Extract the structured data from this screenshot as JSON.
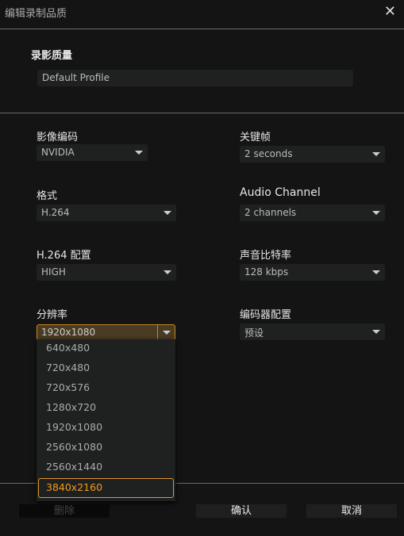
{
  "dialog": {
    "title": "编辑录制品质"
  },
  "quality": {
    "label": "录影质量",
    "profile": "Default Profile"
  },
  "fields": {
    "video_encoder": {
      "label": "影像编码",
      "value": "NVIDIA"
    },
    "keyframe": {
      "label": "关键帧",
      "value": "2 seconds"
    },
    "format": {
      "label": "格式",
      "value": "H.264"
    },
    "audio_channel": {
      "label": "Audio Channel",
      "value": "2 channels"
    },
    "h264_profile": {
      "label": "H.264 配置",
      "value": "HIGH"
    },
    "audio_bitrate": {
      "label": "声音比特率",
      "value": "128 kbps"
    },
    "resolution": {
      "label": "分辨率",
      "value": "1920x1080",
      "options": [
        "640x480",
        "720x480",
        "720x576",
        "1280x720",
        "1920x1080",
        "2560x1080",
        "2560x1440",
        "3840x2160"
      ],
      "highlighted": "3840x2160"
    },
    "encoder_preset": {
      "label": "编码器配置",
      "value": "预设"
    }
  },
  "buttons": {
    "delete": "删除",
    "confirm": "确认",
    "cancel": "取消"
  },
  "colors": {
    "accent": "#f29c1f",
    "background": "#141414"
  }
}
